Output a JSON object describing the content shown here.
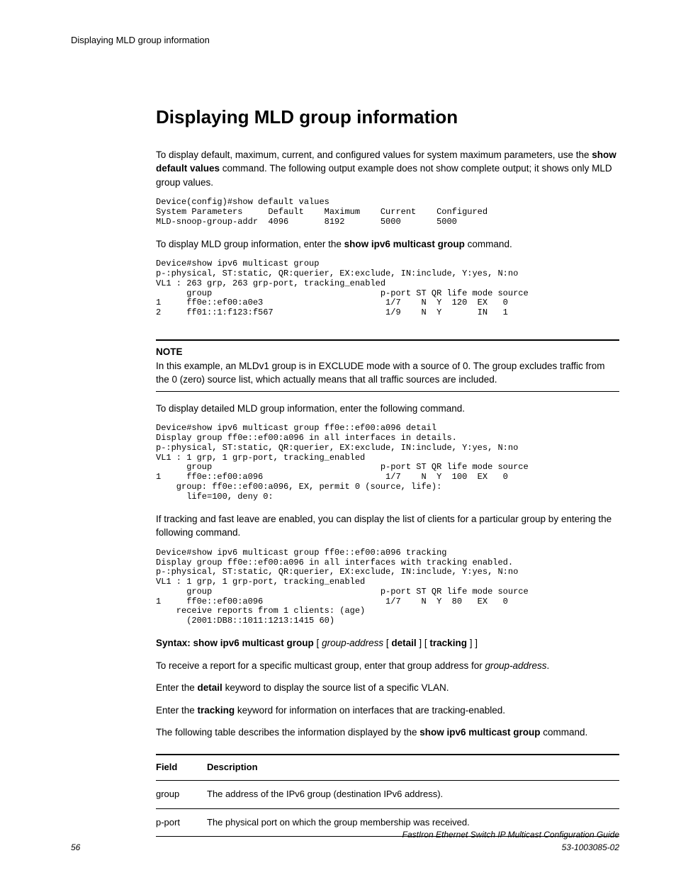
{
  "header": {
    "running": "Displaying MLD group information"
  },
  "title": "Displaying MLD group information",
  "p1_pre": "To display default, maximum, current, and configured values for system maximum parameters, use the ",
  "p1_bold": "show default values",
  "p1_post": " command. The following output example does not show complete output; it shows only MLD group values.",
  "code1": "Device(config)#show default values\nSystem Parameters     Default    Maximum    Current    Configured\nMLD-snoop-group-addr  4096       8192       5000       5000",
  "p2_pre": "To display MLD group information, enter the ",
  "p2_bold": "show ipv6 multicast group",
  "p2_post": " command.",
  "code2": "Device#show ipv6 multicast group\np-:physical, ST:static, QR:querier, EX:exclude, IN:include, Y:yes, N:no\nVL1 : 263 grp, 263 grp-port, tracking_enabled\n      group                                 p-port ST QR life mode source\n1     ff0e::ef00:a0e3                        1/7    N  Y  120  EX   0\n2     ff01::1:f123:f567                      1/9    N  Y       IN   1",
  "note_label": "NOTE",
  "note_text": "In this example, an MLDv1 group is in EXCLUDE mode with a source of 0. The group excludes traffic from the 0 (zero) source list, which actually means that all traffic sources are included.",
  "p3": "To display detailed MLD group information, enter the following command.",
  "code3": "Device#show ipv6 multicast group ff0e::ef00:a096 detail\nDisplay group ff0e::ef00:a096 in all interfaces in details.\np-:physical, ST:static, QR:querier, EX:exclude, IN:include, Y:yes, N:no\nVL1 : 1 grp, 1 grp-port, tracking_enabled\n      group                                 p-port ST QR life mode source\n1     ff0e::ef00:a096                        1/7    N  Y  100  EX   0\n    group: ff0e::ef00:a096, EX, permit 0 (source, life):\n      life=100, deny 0:",
  "p4": "If tracking and fast leave are enabled, you can display the list of clients for a particular group by entering the following command.",
  "code4": "Device#show ipv6 multicast group ff0e::ef00:a096 tracking\nDisplay group ff0e::ef00:a096 in all interfaces with tracking enabled.\np-:physical, ST:static, QR:querier, EX:exclude, IN:include, Y:yes, N:no\nVL1 : 1 grp, 1 grp-port, tracking_enabled\n      group                                 p-port ST QR life mode source\n1     ff0e::ef00:a096                        1/7    N  Y  80   EX   0\n    receive reports from 1 clients: (age)\n      (2001:DB8::1011:1213:1415 60)",
  "syntax": {
    "label": "Syntax: show ipv6 multicast group",
    "br1": " [ ",
    "i1": "group-address",
    "br2": " [ ",
    "b1": "detail",
    "br3": " ] [ ",
    "b2": "tracking",
    "br4": " ] ]"
  },
  "p5_pre": "To receive a report for a specific multicast group, enter that group address for ",
  "p5_i": "group-address",
  "p5_post": ".",
  "p6_pre": "Enter the ",
  "p6_b": "detail",
  "p6_post": " keyword to display the source list of a specific VLAN.",
  "p7_pre": "Enter the ",
  "p7_b": "tracking",
  "p7_post": " keyword for information on interfaces that are tracking-enabled.",
  "p8_pre": "The following table describes the information displayed by the ",
  "p8_b": "show ipv6 multicast group",
  "p8_post": " command.",
  "table": {
    "h1": "Field",
    "h2": "Description",
    "rows": [
      {
        "f": "group",
        "d": "The address of the IPv6 group (destination IPv6 address)."
      },
      {
        "f": "p-port",
        "d": "The physical port on which the group membership was received."
      }
    ]
  },
  "footer": {
    "page": "56",
    "line1": "FastIron Ethernet Switch IP Multicast Configuration Guide",
    "line2": "53-1003085-02"
  }
}
